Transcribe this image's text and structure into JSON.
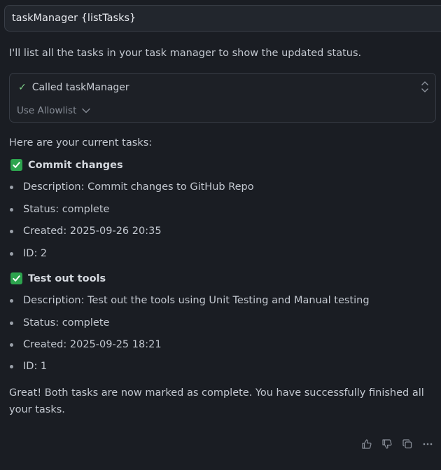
{
  "prompt": {
    "text": "taskManager {listTasks}"
  },
  "intro": "I'll list all the tasks in your task manager to show the updated status.",
  "tool_call": {
    "label": "Called taskManager",
    "allowlist_label": "Use Allowlist"
  },
  "tasks_heading": "Here are your current tasks:",
  "tasks": [
    {
      "title": "Commit changes",
      "description": "Description: Commit changes to GitHub Repo",
      "status": "Status: complete",
      "created": "Created: 2025-09-26 20:35",
      "id": "ID: 2"
    },
    {
      "title": "Test out tools",
      "description": "Description: Test out the tools using Unit Testing and Manual testing",
      "status": "Status: complete",
      "created": "Created: 2025-09-25 18:21",
      "id": "ID: 1"
    }
  ],
  "footer": "Great! Both tasks are now marked as complete. You have successfully finished all your tasks.",
  "icons": {
    "check": "check-icon",
    "thumbs_up": "thumbs-up-icon",
    "thumbs_down": "thumbs-down-icon",
    "copy": "copy-icon",
    "more": "more-icon"
  },
  "colors": {
    "background": "#1a1d23",
    "success_green": "#2da44e"
  }
}
